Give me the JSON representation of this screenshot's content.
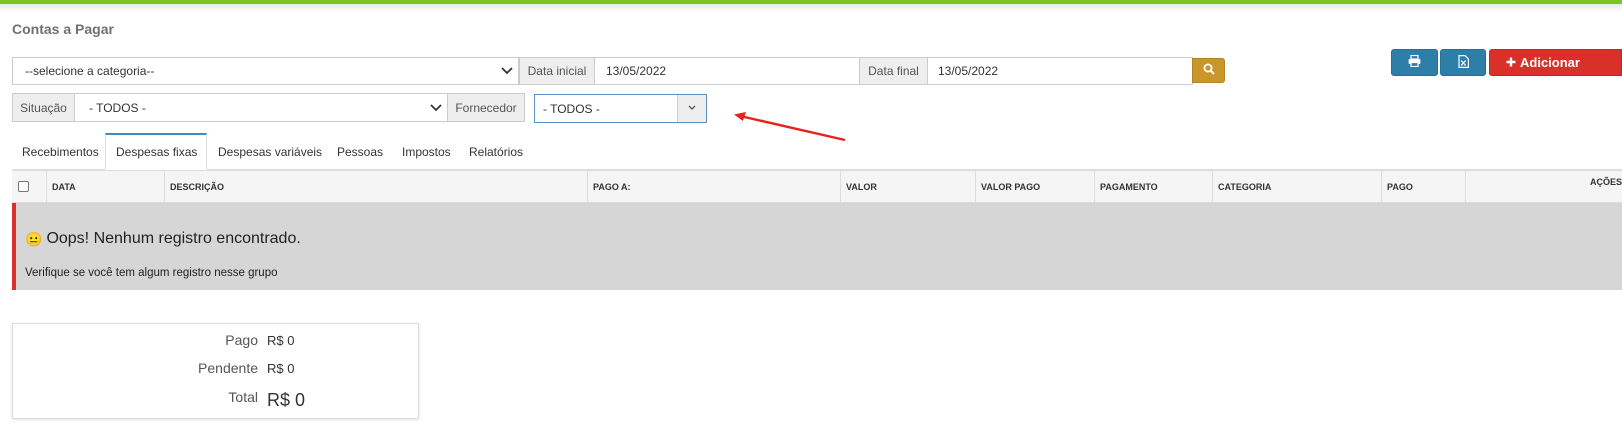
{
  "page": {
    "title": "Contas a Pagar"
  },
  "filters": {
    "category_value": "--selecione a categoria--",
    "date_start_label": "Data inicial",
    "date_start_value": "13/05/2022",
    "date_end_label": "Data final",
    "date_end_value": "13/05/2022",
    "situation_label": "Situação",
    "situation_value": "- TODOS -",
    "supplier_label": "Fornecedor",
    "supplier_value": "- TODOS -"
  },
  "actions": {
    "print_icon": "printer-icon",
    "excel_icon": "excel-icon",
    "add_label": "Adicionar",
    "search_icon": "search-icon"
  },
  "tabs": [
    {
      "label": "Recebimentos",
      "active": false
    },
    {
      "label": "Despesas fixas",
      "active": true
    },
    {
      "label": "Despesas variáveis",
      "active": false
    },
    {
      "label": "Pessoas",
      "active": false
    },
    {
      "label": "Impostos",
      "active": false
    },
    {
      "label": "Relatórios",
      "active": false
    }
  ],
  "table": {
    "columns": [
      "DATA",
      "DESCRIÇÃO",
      "PAGO A:",
      "VALOR",
      "VALOR PAGO",
      "PAGAMENTO",
      "CATEGORIA",
      "PAGO",
      "AÇÕES"
    ]
  },
  "empty": {
    "emoji": "😐",
    "title": "Oops! Nenhum registro encontrado.",
    "subtitle": "Verifique se você tem algum registro nesse grupo"
  },
  "summary": {
    "paid_label": "Pago",
    "paid_value": "R$ 0",
    "pending_label": "Pendente",
    "pending_value": "R$ 0",
    "total_label": "Total",
    "total_value": "R$ 0"
  },
  "colors": {
    "top_bar": "#7cc520",
    "primary": "#2e7fa8",
    "danger": "#d9312a",
    "search": "#c9962a",
    "annotation_arrow": "#e8221b"
  }
}
